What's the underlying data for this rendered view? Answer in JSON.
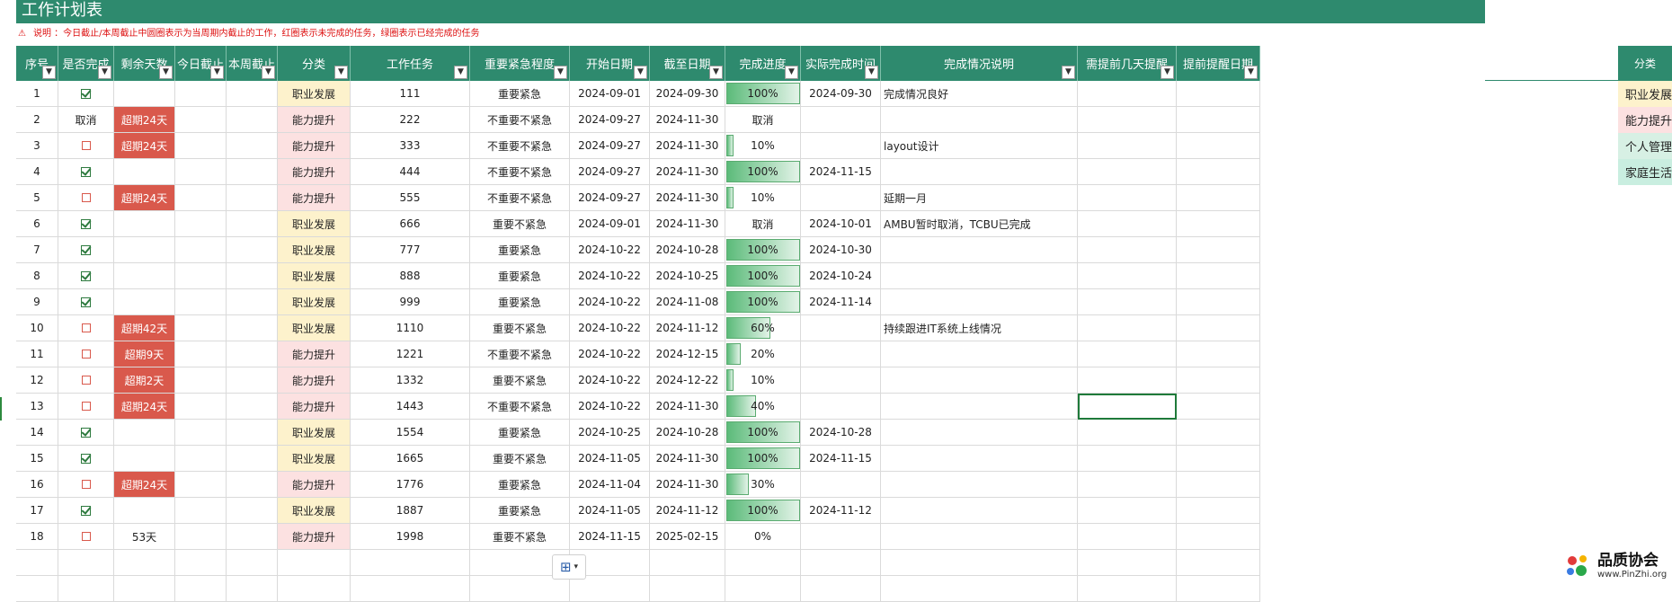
{
  "title": "工作计划表",
  "note": {
    "icon": "warning-icon",
    "text": "说明 ：今日截止/本周截止中圆圈表示为当周期内截止的工作，红圈表示未完成的任务，绿圈表示已经完成的任务"
  },
  "columns": [
    "序号",
    "是否完成",
    "剩余天数",
    "今日截止",
    "本周截止",
    "分类",
    "工作任务",
    "重要紧急程度",
    "开始日期",
    "截至日期",
    "完成进度",
    "实际完成时间",
    "完成情况说明",
    "需提前几天提醒",
    "提前提醒日期"
  ],
  "filter_icon": "▼",
  "colors": {
    "header": "#2e8a6e",
    "overdue": "#d9594c",
    "category_career": "#fdf2cc",
    "category_ability": "#fce1e1",
    "progress": "#5cbb7a"
  },
  "rows": [
    {
      "no": "1",
      "done_state": "checked",
      "remaining": "",
      "remaining_style": "",
      "category": "职业发展",
      "task": "111",
      "priority": "重要紧急",
      "start": "2024-09-01",
      "due": "2024-09-30",
      "progress_value": 1.0,
      "progress_text": "100%",
      "actual": "2024-09-30",
      "desc": "完成情况良好"
    },
    {
      "no": "2",
      "done_state": "text",
      "done_text": "取消",
      "remaining": "超期24天",
      "remaining_style": "overdue",
      "category": "能力提升",
      "task": "222",
      "priority": "不重要不紧急",
      "start": "2024-09-27",
      "due": "2024-11-30",
      "progress_value": 0,
      "progress_text": "取消",
      "actual": "",
      "desc": ""
    },
    {
      "no": "3",
      "done_state": "unchecked",
      "remaining": "超期24天",
      "remaining_style": "overdue",
      "category": "能力提升",
      "task": "333",
      "priority": "不重要不紧急",
      "start": "2024-09-27",
      "due": "2024-11-30",
      "progress_value": 0.1,
      "progress_text": "10%",
      "actual": "",
      "desc": "layout设计"
    },
    {
      "no": "4",
      "done_state": "checked",
      "remaining": "",
      "remaining_style": "",
      "category": "能力提升",
      "task": "444",
      "priority": "不重要不紧急",
      "start": "2024-09-27",
      "due": "2024-11-30",
      "progress_value": 1.0,
      "progress_text": "100%",
      "actual": "2024-11-15",
      "desc": ""
    },
    {
      "no": "5",
      "done_state": "unchecked",
      "remaining": "超期24天",
      "remaining_style": "overdue",
      "category": "能力提升",
      "task": "555",
      "priority": "不重要不紧急",
      "start": "2024-09-27",
      "due": "2024-11-30",
      "progress_value": 0.1,
      "progress_text": "10%",
      "actual": "",
      "desc": "延期一月"
    },
    {
      "no": "6",
      "done_state": "checked",
      "remaining": "",
      "remaining_style": "",
      "category": "职业发展",
      "task": "666",
      "priority": "重要不紧急",
      "start": "2024-09-01",
      "due": "2024-11-30",
      "progress_value": 0,
      "progress_text": "取消",
      "actual": "2024-10-01",
      "desc": "AMBU暂时取消，TCBU已完成"
    },
    {
      "no": "7",
      "done_state": "checked",
      "remaining": "",
      "remaining_style": "",
      "category": "职业发展",
      "task": "777",
      "priority": "重要紧急",
      "start": "2024-10-22",
      "due": "2024-10-28",
      "progress_value": 1.0,
      "progress_text": "100%",
      "actual": "2024-10-30",
      "desc": ""
    },
    {
      "no": "8",
      "done_state": "checked",
      "remaining": "",
      "remaining_style": "",
      "category": "职业发展",
      "task": "888",
      "priority": "重要紧急",
      "start": "2024-10-22",
      "due": "2024-10-25",
      "progress_value": 1.0,
      "progress_text": "100%",
      "actual": "2024-10-24",
      "desc": ""
    },
    {
      "no": "9",
      "done_state": "checked",
      "remaining": "",
      "remaining_style": "",
      "category": "职业发展",
      "task": "999",
      "priority": "重要紧急",
      "start": "2024-10-22",
      "due": "2024-11-08",
      "progress_value": 1.0,
      "progress_text": "100%",
      "actual": "2024-11-14",
      "desc": ""
    },
    {
      "no": "10",
      "done_state": "unchecked",
      "remaining": "超期42天",
      "remaining_style": "overdue",
      "category": "职业发展",
      "task": "1110",
      "priority": "重要不紧急",
      "start": "2024-10-22",
      "due": "2024-11-12",
      "progress_value": 0.6,
      "progress_text": "60%",
      "actual": "",
      "desc": "持续跟进IT系统上线情况"
    },
    {
      "no": "11",
      "done_state": "unchecked",
      "remaining": "超期9天",
      "remaining_style": "overdue",
      "category": "能力提升",
      "task": "1221",
      "priority": "不重要不紧急",
      "start": "2024-10-22",
      "due": "2024-12-15",
      "progress_value": 0.2,
      "progress_text": "20%",
      "actual": "",
      "desc": ""
    },
    {
      "no": "12",
      "done_state": "unchecked",
      "remaining": "超期2天",
      "remaining_style": "overdue",
      "category": "能力提升",
      "task": "1332",
      "priority": "重要不紧急",
      "start": "2024-10-22",
      "due": "2024-12-22",
      "progress_value": 0.1,
      "progress_text": "10%",
      "actual": "",
      "desc": ""
    },
    {
      "no": "13",
      "done_state": "unchecked",
      "remaining": "超期24天",
      "remaining_style": "overdue",
      "category": "能力提升",
      "task": "1443",
      "priority": "不重要不紧急",
      "start": "2024-10-22",
      "due": "2024-11-30",
      "progress_value": 0.4,
      "progress_text": "40%",
      "actual": "",
      "desc": ""
    },
    {
      "no": "14",
      "done_state": "checked",
      "remaining": "",
      "remaining_style": "",
      "category": "职业发展",
      "task": "1554",
      "priority": "重要紧急",
      "start": "2024-10-25",
      "due": "2024-10-28",
      "progress_value": 1.0,
      "progress_text": "100%",
      "actual": "2024-10-28",
      "desc": ""
    },
    {
      "no": "15",
      "done_state": "checked",
      "remaining": "",
      "remaining_style": "",
      "category": "职业发展",
      "task": "1665",
      "priority": "重要不紧急",
      "start": "2024-11-05",
      "due": "2024-11-30",
      "progress_value": 1.0,
      "progress_text": "100%",
      "actual": "2024-11-15",
      "desc": ""
    },
    {
      "no": "16",
      "done_state": "unchecked",
      "remaining": "超期24天",
      "remaining_style": "overdue",
      "category": "能力提升",
      "task": "1776",
      "priority": "重要紧急",
      "start": "2024-11-04",
      "due": "2024-11-30",
      "progress_value": 0.3,
      "progress_text": "30%",
      "actual": "",
      "desc": ""
    },
    {
      "no": "17",
      "done_state": "checked",
      "remaining": "",
      "remaining_style": "",
      "category": "职业发展",
      "task": "1887",
      "priority": "重要紧急",
      "start": "2024-11-05",
      "due": "2024-11-12",
      "progress_value": 1.0,
      "progress_text": "100%",
      "actual": "2024-11-12",
      "desc": ""
    },
    {
      "no": "18",
      "done_state": "unchecked",
      "remaining": "53天",
      "remaining_style": "",
      "category": "能力提升",
      "task": "1998",
      "priority": "重要不紧急",
      "start": "2024-11-15",
      "due": "2025-02-15",
      "progress_value": 0,
      "progress_text": "0%",
      "actual": "",
      "desc": ""
    }
  ],
  "category_panel": {
    "header": "分类",
    "items": [
      {
        "label": "职业发展",
        "color": "#fdf2cc"
      },
      {
        "label": "能力提升",
        "color": "#fce1e1"
      },
      {
        "label": "个人管理",
        "color": "#d7f0e4"
      },
      {
        "label": "家庭生活",
        "color": "#c9eee0"
      }
    ]
  },
  "quick_analysis_icon": "table-quick-analysis-icon",
  "logo": {
    "name": "品质协会",
    "url": "www.PinZhi.org"
  }
}
